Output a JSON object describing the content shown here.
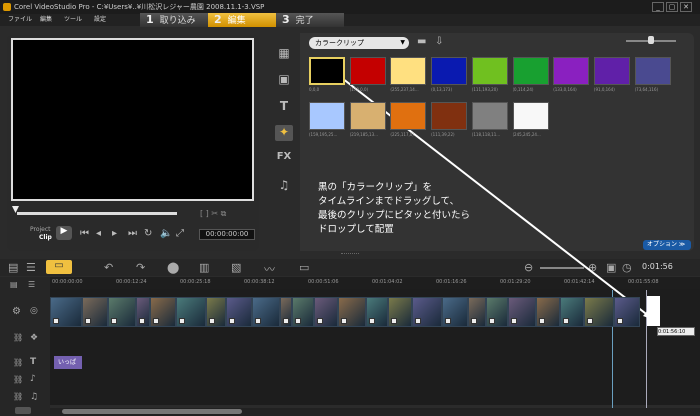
{
  "window": {
    "title": "Corel VideoStudio Pro - C:¥Users¥..¥川松沢レジャー農園 2008.11.1-3.VSP",
    "controls": [
      "_",
      "▢",
      "✕"
    ]
  },
  "menu": [
    "ファイル",
    "編集",
    "ツール",
    "設定"
  ],
  "steps": [
    {
      "num": "1",
      "label": "取り込み"
    },
    {
      "num": "2",
      "label": "編集"
    },
    {
      "num": "3",
      "label": "完了"
    }
  ],
  "player": {
    "project_label": "Project",
    "clip_label": "Clip",
    "timecode": "00:00:00:00"
  },
  "library": {
    "dropdown": "カラークリップ",
    "options_label": "オプション ≫",
    "swatches": [
      {
        "color": "#000000",
        "label": "0,0,0"
      },
      {
        "color": "#c40000",
        "label": "(179,0,0)"
      },
      {
        "color": "#ffe080",
        "label": "(255,237,14..."
      },
      {
        "color": "#0a1ab0",
        "label": "(0,13,173)"
      },
      {
        "color": "#70c020",
        "label": "(111,193,20)"
      },
      {
        "color": "#18a030",
        "label": "(0,114,24)"
      },
      {
        "color": "#8a20c0",
        "label": "(133,0,164)"
      },
      {
        "color": "#6020a8",
        "label": "(91,0,164)"
      },
      {
        "color": "#4a4a90",
        "label": "(73,64,116)"
      },
      {
        "color": "#a8c8ff",
        "label": "(159,195,25..."
      },
      {
        "color": "#d8b070",
        "label": "(219,185,13..."
      },
      {
        "color": "#e07010",
        "label": "(225,117,0)"
      },
      {
        "color": "#803010",
        "label": "(111,39,22)"
      },
      {
        "color": "#808080",
        "label": "(118,118,11..."
      },
      {
        "color": "#f8f8f8",
        "label": "(245,245,24..."
      }
    ]
  },
  "annotation": [
    "黒の「カラークリップ」を",
    "タイムラインまでドラッグして、",
    "最後のクリップにピタッと付いたら",
    "ドロップして配置"
  ],
  "timeline": {
    "timecode": "0:01:56",
    "ruler": [
      "00:00:00:00",
      "00:00:12:24",
      "00:00:25:18",
      "00:00:38:12",
      "00:00:51:06",
      "00:01:04:02",
      "00:01:16:26",
      "00:01:29:20",
      "00:01:42:14",
      "00:01:55:08"
    ],
    "drop_timecode": "0:01:56:10",
    "title_clip": "いっぱ"
  }
}
